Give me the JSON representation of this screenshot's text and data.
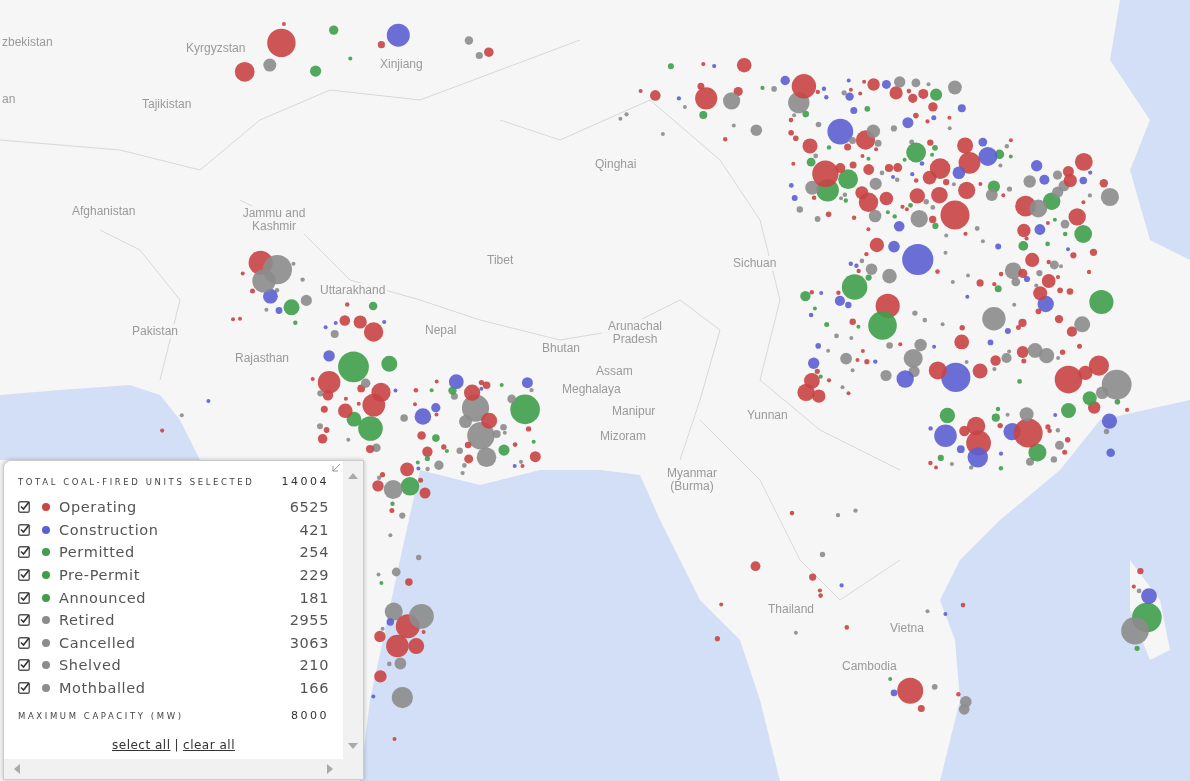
{
  "map": {
    "labels": [
      {
        "text": "zbekistan"
      },
      {
        "text": "an"
      },
      {
        "text": "Kyrgyzstan"
      },
      {
        "text": "Tajikistan"
      },
      {
        "text": "Xinjiang"
      },
      {
        "text": "Afghanistan"
      },
      {
        "text": "Jammu and Kashmir"
      },
      {
        "text": "Tibet"
      },
      {
        "text": "Qinghai"
      },
      {
        "text": "Uttarakhand"
      },
      {
        "text": "Pakistan"
      },
      {
        "text": "Nepal"
      },
      {
        "text": "Rajasthan"
      },
      {
        "text": "Bhutan"
      },
      {
        "text": "Arunachal Pradesh"
      },
      {
        "text": "Sichuan"
      },
      {
        "text": "Assam"
      },
      {
        "text": "Meghalaya"
      },
      {
        "text": "Manipur"
      },
      {
        "text": "Mizoram"
      },
      {
        "text": "Yunnan"
      },
      {
        "text": "Myanmar (Burma)"
      },
      {
        "text": "Thailand"
      },
      {
        "text": "Vietna"
      },
      {
        "text": "Cambodia"
      }
    ]
  },
  "legend": {
    "title": "TOTAL COAL-FIRED UNITS SELECTED",
    "total": "14004",
    "rows": [
      {
        "label": "Operating",
        "count": "6525",
        "checked": true,
        "color": "#c94444"
      },
      {
        "label": "Construction",
        "count": "421",
        "checked": true,
        "color": "#5b5fd2"
      },
      {
        "label": "Permitted",
        "count": "254",
        "checked": true,
        "color": "#3f9e4a"
      },
      {
        "label": "Pre-Permit",
        "count": "229",
        "checked": true,
        "color": "#3f9e4a"
      },
      {
        "label": "Announced",
        "count": "181",
        "checked": true,
        "color": "#3f9e4a"
      },
      {
        "label": "Retired",
        "count": "2955",
        "checked": true,
        "color": "#8c8c8c"
      },
      {
        "label": "Cancelled",
        "count": "3063",
        "checked": true,
        "color": "#8c8c8c"
      },
      {
        "label": "Shelved",
        "count": "210",
        "checked": true,
        "color": "#8c8c8c"
      },
      {
        "label": "Mothballed",
        "count": "166",
        "checked": true,
        "color": "#8c8c8c"
      }
    ],
    "capacity_label": "MAXIMUM CAPACITY (MW)",
    "capacity": "8000",
    "links": [
      "select all",
      "clear all"
    ],
    "separator": "|"
  }
}
